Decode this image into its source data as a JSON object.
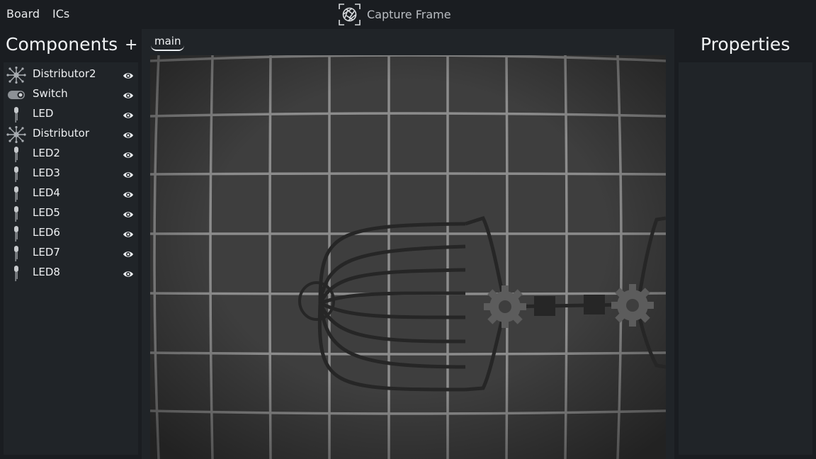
{
  "menu": {
    "board": "Board",
    "ics": "ICs"
  },
  "capture": {
    "label": "Capture Frame",
    "icon": "aperture-icon"
  },
  "components": {
    "title": "Components",
    "add_label": "+",
    "items": [
      {
        "name": "Distributor2",
        "icon": "distributor-icon"
      },
      {
        "name": "Switch",
        "icon": "switch-icon"
      },
      {
        "name": "LED",
        "icon": "led-icon"
      },
      {
        "name": "Distributor",
        "icon": "distributor-icon"
      },
      {
        "name": "LED2",
        "icon": "led-icon"
      },
      {
        "name": "LED3",
        "icon": "led-icon"
      },
      {
        "name": "LED4",
        "icon": "led-icon"
      },
      {
        "name": "LED5",
        "icon": "led-icon"
      },
      {
        "name": "LED6",
        "icon": "led-icon"
      },
      {
        "name": "LED7",
        "icon": "led-icon"
      },
      {
        "name": "LED8",
        "icon": "led-icon"
      }
    ]
  },
  "tabs": [
    {
      "label": "main",
      "active": true
    }
  ],
  "properties": {
    "title": "Properties"
  },
  "colors": {
    "background": "#1a1d21",
    "panel": "#202428",
    "canvas": "#3e3e3e",
    "grid": "#9a9a9a",
    "wire": "#262626",
    "gear": "#5c5c5c"
  }
}
